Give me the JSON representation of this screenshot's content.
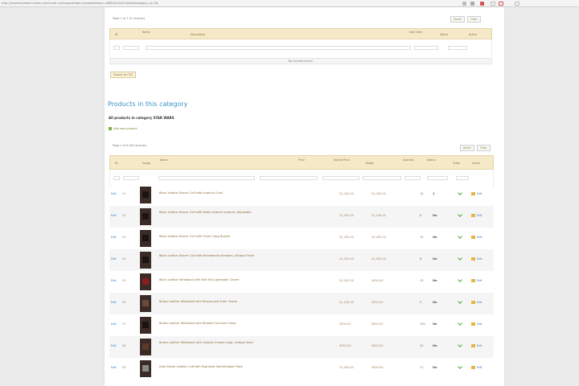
{
  "browser": {
    "url": "http://localhost/admin/index.php?route=catalog/category/update&token=a8f6d2e1b9c34d5e&category_id=28"
  },
  "filters_grid": {
    "pager": "Page 1 of 1 (0 records)",
    "reset_label": "Reset",
    "filter_label": "Filter",
    "columns": [
      "ID",
      "Name",
      "Description",
      "Sort Order",
      "Status",
      "Action"
    ],
    "no_records": "No records found.",
    "export_label": "Export to CSV"
  },
  "products_section": {
    "title": "Products in this category",
    "subtitle": "All products in category STAR WARS",
    "add_label": "Add new product"
  },
  "products_grid": {
    "pager": "Page 1 of 6 (56 records)",
    "reset_label": "Reset",
    "filter_label": "Filter",
    "columns": [
      "ID",
      "Image",
      "Name",
      "Price",
      "Special Price",
      "Model",
      "Quantity",
      "Status",
      "Order",
      "Action"
    ],
    "rows": [
      {
        "edit": "Edit",
        "id": "51",
        "name": "Black Leather Bracer Cuff with Imperial Crest",
        "price": "$1,200.00",
        "special": "$1,000.00",
        "qty": "10",
        "status": "1",
        "action": "Edit"
      },
      {
        "edit": "Edit",
        "id": "52",
        "name": "Black Leather Bracer Cuff with Rebel Alliance Insignia, Adjustable",
        "price": "$1,350.00",
        "special": "$1,100.00",
        "qty": "8",
        "status": "On",
        "action": "Edit"
      },
      {
        "edit": "Edit",
        "id": "53",
        "name": "Black Leather Bracer Cuff with Silver Clasp Buckle",
        "price": "$1,200.00",
        "special": "$1,000.00",
        "qty": "12",
        "status": "On",
        "action": "Edit"
      },
      {
        "edit": "Edit",
        "id": "54",
        "name": "Black Leather Bracer Cuff with Mandalorian Emblem, Antique Finish",
        "price": "$1,250.00",
        "special": "$1,050.00",
        "qty": "6",
        "status": "On",
        "action": "Edit"
      },
      {
        "edit": "Edit",
        "id": "55",
        "name": "Black Leather Wristband with Red Sith Lightsaber Charm",
        "price": "$1,000.00",
        "special": "$900.00",
        "qty": "15",
        "status": "On",
        "action": "Edit"
      },
      {
        "edit": "Edit",
        "id": "56",
        "name": "Brown Leather Wristband with Bronze Jedi Order Charm",
        "price": "$1,100.00",
        "special": "$950.00",
        "qty": "9",
        "status": "On",
        "action": "Edit"
      },
      {
        "edit": "Edit",
        "id": "57",
        "name": "Brown Leather Wristband with Braided Cord and Clasp",
        "price": "$900.00",
        "special": "$800.00",
        "qty": "100",
        "status": "On",
        "action": "Edit"
      },
      {
        "edit": "Edit",
        "id": "58",
        "name": "Brown Leather Wristband with Galactic Empire Logo, Vintage Style",
        "price": "$950.00",
        "special": "$850.00",
        "qty": "20",
        "status": "On",
        "action": "Edit"
      },
      {
        "edit": "Edit",
        "id": "59",
        "name": "Dark Brown Leather Cuff with Engraved Stormtrooper Plate",
        "price": "$1,000.00",
        "special": "$900.00",
        "qty": "11",
        "status": "On",
        "action": "Edit"
      }
    ]
  }
}
